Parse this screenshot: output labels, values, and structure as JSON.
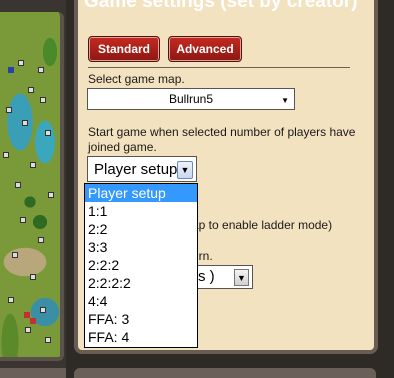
{
  "panel": {
    "title": "Game settings (set by creator)"
  },
  "tabs": {
    "standard": "Standard",
    "advanced": "Advanced"
  },
  "map_select": {
    "label": "Select game map.",
    "value": "Bullrun5"
  },
  "players": {
    "label_line1": "Start game when selected number of players have",
    "label_line2": "joined game.",
    "value": "Player setup",
    "options": [
      "Player setup",
      "1:1",
      "2:2",
      "3:3",
      "2:2:2",
      "2:2:2:2",
      "4:4",
      "FFA: 3",
      "FFA: 4"
    ]
  },
  "partially_hidden": {
    "ladder_text": "ap to enable ladder mode)",
    "turn_text": "urn.",
    "select_value": "s )"
  },
  "colors": {
    "panel_bg": "#f3e2bf",
    "button_red": "#b0211a",
    "highlight": "#3399ff"
  }
}
